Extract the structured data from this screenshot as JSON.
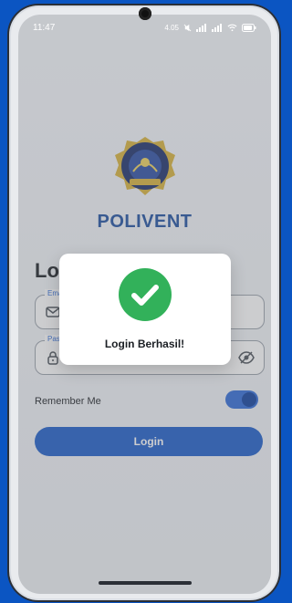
{
  "status": {
    "time": "11:47",
    "icons": [
      "network-speed-icon",
      "mute-icon",
      "signal-icon",
      "signal-icon",
      "wifi-icon",
      "battery-icon"
    ]
  },
  "brand": {
    "name": "POLIVENT",
    "logo_text": "politeknik negeri SEMARANG"
  },
  "form": {
    "title": "Log",
    "email_label": "Email",
    "password_label": "Passw",
    "remember_label": "Remember Me",
    "remember_on": true,
    "login_button": "Login"
  },
  "dialog": {
    "message": "Login Berhasil!"
  },
  "colors": {
    "accent": "#1d5cc9",
    "success": "#32b15a",
    "brand": "#1e4fa0"
  }
}
